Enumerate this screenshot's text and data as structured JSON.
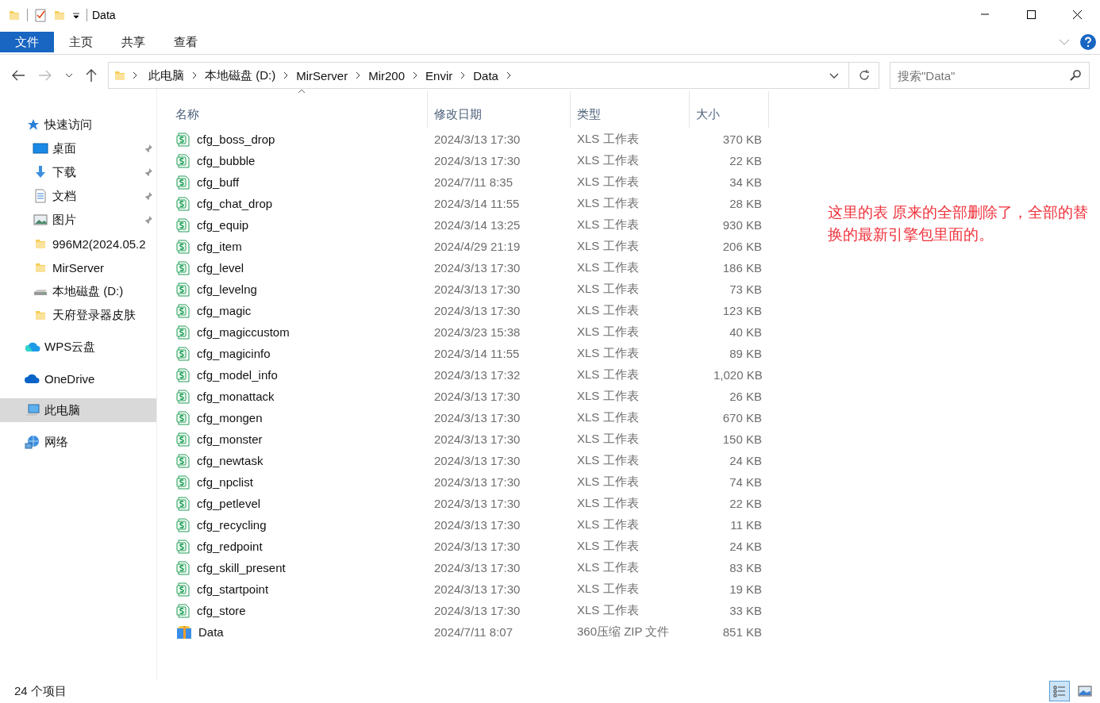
{
  "window": {
    "title": "Data"
  },
  "ribbon": {
    "tabs": [
      {
        "label": "文件",
        "selected": true
      },
      {
        "label": "主页",
        "selected": false
      },
      {
        "label": "共享",
        "selected": false
      },
      {
        "label": "查看",
        "selected": false
      }
    ]
  },
  "address": {
    "segments": [
      "此电脑",
      "本地磁盘 (D:)",
      "MirServer",
      "Mir200",
      "Envir",
      "Data"
    ]
  },
  "search": {
    "placeholder": "搜索\"Data\""
  },
  "sidebar": {
    "items": [
      {
        "label": "快速访问",
        "kind": "star",
        "selected": false,
        "children": [
          {
            "label": "桌面",
            "kind": "desktop",
            "pinned": true,
            "selected": false
          },
          {
            "label": "下载",
            "kind": "download",
            "pinned": true,
            "selected": false
          },
          {
            "label": "文档",
            "kind": "document",
            "pinned": true,
            "selected": false
          },
          {
            "label": "图片",
            "kind": "picture",
            "pinned": true,
            "selected": false
          },
          {
            "label": "996M2(2024.05.2",
            "kind": "folder",
            "pinned": false,
            "selected": false
          },
          {
            "label": "MirServer",
            "kind": "folder",
            "pinned": false,
            "selected": false
          },
          {
            "label": "本地磁盘 (D:)",
            "kind": "drive",
            "pinned": false,
            "selected": false
          },
          {
            "label": "天府登录器皮肤",
            "kind": "folder",
            "pinned": false,
            "selected": false
          }
        ]
      },
      {
        "label": "WPS云盘",
        "kind": "wps",
        "selected": false
      },
      {
        "label": "OneDrive",
        "kind": "cloud",
        "selected": false
      },
      {
        "label": "此电脑",
        "kind": "pc",
        "selected": true
      },
      {
        "label": "网络",
        "kind": "network",
        "selected": false
      }
    ]
  },
  "table": {
    "columns": [
      {
        "label": "名称",
        "sorted": true
      },
      {
        "label": "修改日期",
        "sorted": false
      },
      {
        "label": "类型",
        "sorted": false
      },
      {
        "label": "大小",
        "sorted": false
      }
    ],
    "rows": [
      {
        "kind": "xls",
        "name": "cfg_boss_drop",
        "date": "2024/3/13 17:30",
        "type": "XLS 工作表",
        "size": "370 KB"
      },
      {
        "kind": "xls",
        "name": "cfg_bubble",
        "date": "2024/3/13 17:30",
        "type": "XLS 工作表",
        "size": "22 KB"
      },
      {
        "kind": "xls",
        "name": "cfg_buff",
        "date": "2024/7/11 8:35",
        "type": "XLS 工作表",
        "size": "34 KB"
      },
      {
        "kind": "xls",
        "name": "cfg_chat_drop",
        "date": "2024/3/14 11:55",
        "type": "XLS 工作表",
        "size": "28 KB"
      },
      {
        "kind": "xls",
        "name": "cfg_equip",
        "date": "2024/3/14 13:25",
        "type": "XLS 工作表",
        "size": "930 KB"
      },
      {
        "kind": "xls",
        "name": "cfg_item",
        "date": "2024/4/29 21:19",
        "type": "XLS 工作表",
        "size": "206 KB"
      },
      {
        "kind": "xls",
        "name": "cfg_level",
        "date": "2024/3/13 17:30",
        "type": "XLS 工作表",
        "size": "186 KB"
      },
      {
        "kind": "xls",
        "name": "cfg_levelng",
        "date": "2024/3/13 17:30",
        "type": "XLS 工作表",
        "size": "73 KB"
      },
      {
        "kind": "xls",
        "name": "cfg_magic",
        "date": "2024/3/13 17:30",
        "type": "XLS 工作表",
        "size": "123 KB"
      },
      {
        "kind": "xls",
        "name": "cfg_magiccustom",
        "date": "2024/3/23 15:38",
        "type": "XLS 工作表",
        "size": "40 KB"
      },
      {
        "kind": "xls",
        "name": "cfg_magicinfo",
        "date": "2024/3/14 11:55",
        "type": "XLS 工作表",
        "size": "89 KB"
      },
      {
        "kind": "xls",
        "name": "cfg_model_info",
        "date": "2024/3/13 17:32",
        "type": "XLS 工作表",
        "size": "1,020 KB"
      },
      {
        "kind": "xls",
        "name": "cfg_monattack",
        "date": "2024/3/13 17:30",
        "type": "XLS 工作表",
        "size": "26 KB"
      },
      {
        "kind": "xls",
        "name": "cfg_mongen",
        "date": "2024/3/13 17:30",
        "type": "XLS 工作表",
        "size": "670 KB"
      },
      {
        "kind": "xls",
        "name": "cfg_monster",
        "date": "2024/3/13 17:30",
        "type": "XLS 工作表",
        "size": "150 KB"
      },
      {
        "kind": "xls",
        "name": "cfg_newtask",
        "date": "2024/3/13 17:30",
        "type": "XLS 工作表",
        "size": "24 KB"
      },
      {
        "kind": "xls",
        "name": "cfg_npclist",
        "date": "2024/3/13 17:30",
        "type": "XLS 工作表",
        "size": "74 KB"
      },
      {
        "kind": "xls",
        "name": "cfg_petlevel",
        "date": "2024/3/13 17:30",
        "type": "XLS 工作表",
        "size": "22 KB"
      },
      {
        "kind": "xls",
        "name": "cfg_recycling",
        "date": "2024/3/13 17:30",
        "type": "XLS 工作表",
        "size": "11 KB"
      },
      {
        "kind": "xls",
        "name": "cfg_redpoint",
        "date": "2024/3/13 17:30",
        "type": "XLS 工作表",
        "size": "24 KB"
      },
      {
        "kind": "xls",
        "name": "cfg_skill_present",
        "date": "2024/3/13 17:30",
        "type": "XLS 工作表",
        "size": "83 KB"
      },
      {
        "kind": "xls",
        "name": "cfg_startpoint",
        "date": "2024/3/13 17:30",
        "type": "XLS 工作表",
        "size": "19 KB"
      },
      {
        "kind": "xls",
        "name": "cfg_store",
        "date": "2024/3/13 17:30",
        "type": "XLS 工作表",
        "size": "33 KB"
      },
      {
        "kind": "zip",
        "name": "Data",
        "date": "2024/7/11 8:07",
        "type": "360压缩 ZIP 文件",
        "size": "851 KB"
      }
    ]
  },
  "note": "这里的表 原来的全部删除了，全部的替换的最新引擎包里面的。",
  "status_bar": {
    "count": "24 个项目"
  }
}
